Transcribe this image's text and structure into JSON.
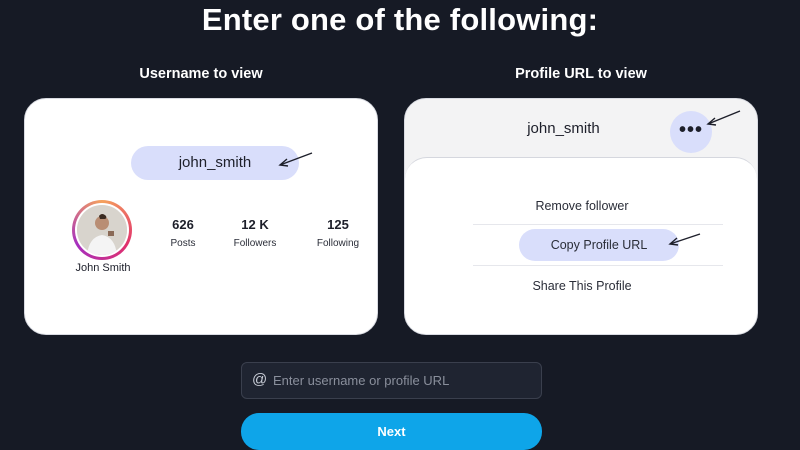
{
  "headline": "Enter one of the following:",
  "left_column": {
    "label": "Username to view",
    "username_pill": "john_smith",
    "profile_name": "John Smith",
    "stats": [
      {
        "value": "626",
        "label": "Posts"
      },
      {
        "value": "12 K",
        "label": "Followers"
      },
      {
        "value": "125",
        "label": "Following"
      }
    ]
  },
  "right_column": {
    "label": "Profile URL to view",
    "username": "john_smith",
    "more_button": "•••",
    "menu": {
      "remove_follower": "Remove follower",
      "copy_profile_url": "Copy Profile URL",
      "share_profile": "Share This Profile"
    }
  },
  "form": {
    "at_symbol": "@",
    "input_placeholder": "Enter username or profile URL",
    "input_value": "",
    "next_label": "Next"
  },
  "colors": {
    "background": "#161a25",
    "accent_blue": "#0ea5e9",
    "highlight_pill": "#d9defb"
  },
  "icons": {
    "arrow": "arrow-pointer-icon",
    "at": "at-icon",
    "more": "more-dots-icon"
  }
}
